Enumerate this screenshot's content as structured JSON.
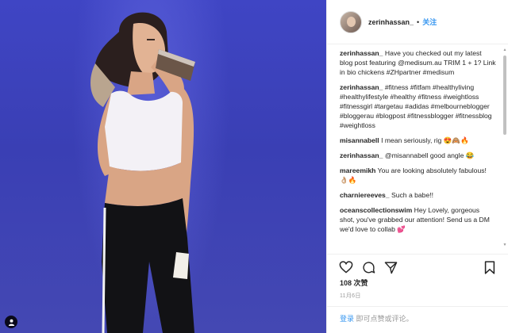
{
  "header": {
    "username": "zerinhassan_",
    "dot": "•",
    "follow_label": "关注"
  },
  "comments": [
    {
      "user": "zerinhassan_",
      "text": "Have you checked out my latest blog post featuring @medisum.au TRIM 1 + 1? Link in bio chickens #ZHpartner #medisum"
    },
    {
      "user": "zerinhassan_",
      "text": "#fitness #fitfam #healthyliving #healthylifestyle #healthy #fitness #weightloss #fitnessgirl #targetau #adidas #melbourneblogger #bloggerau #blogpost #fitnessblogger #fitnessblog #weightloss"
    },
    {
      "user": "misannabell",
      "text": "I mean seriously, rig 😍🙈🔥"
    },
    {
      "user": "zerinhassan_",
      "text": "@misannabell good angle 😂"
    },
    {
      "user": "mareemikh",
      "text": "You are looking absolutely fabulous! 👌🏼🔥"
    },
    {
      "user": "charniereeves_",
      "text": "Such a babe!!"
    },
    {
      "user": "oceanscollectionswim",
      "text": "Hey Lovely, gorgeous shot, you've grabbed our attention! Send us a DM we'd love to collab 💕"
    }
  ],
  "icons": {
    "like": "heart-icon",
    "comment": "speech-bubble-icon",
    "share": "send-icon",
    "save": "bookmark-icon",
    "tag": "user-tag-icon"
  },
  "likes_text": "108 次赞",
  "date_text": "11月6日",
  "footer": {
    "login_label": "登录",
    "rest_text": "即可点赞或评论。"
  },
  "colors": {
    "link": "#3897f0",
    "background_wall": "#3f45c4"
  }
}
